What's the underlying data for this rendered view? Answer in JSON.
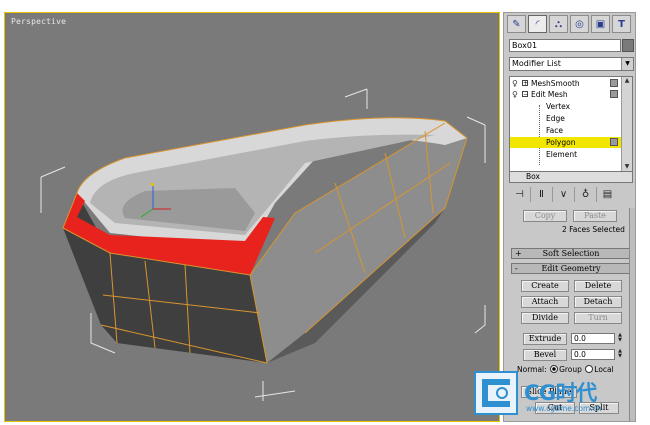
{
  "viewport": {
    "label": "Perspective"
  },
  "command_panel": {
    "tabs": [
      {
        "icon": "create-tab-icon",
        "glyph": "✎"
      },
      {
        "icon": "modify-tab-icon",
        "glyph": "◜"
      },
      {
        "icon": "hierarchy-tab-icon",
        "glyph": "⛬"
      },
      {
        "icon": "motion-tab-icon",
        "glyph": "◎"
      },
      {
        "icon": "display-tab-icon",
        "glyph": "▣"
      },
      {
        "icon": "utilities-tab-icon",
        "glyph": "T"
      }
    ],
    "object_name": "Box01",
    "modifier_list": "Modifier List",
    "stack": {
      "meshsmooth": "MeshSmooth",
      "edit_mesh": "Edit Mesh",
      "vertex": "Vertex",
      "edge": "Edge",
      "face": "Face",
      "polygon": "Polygon",
      "element": "Element",
      "base": "Box"
    },
    "stack_selected": "Polygon",
    "selection": {
      "copy": "Copy",
      "paste": "Paste",
      "status": "2 Faces Selected"
    },
    "soft_selection": {
      "toggle": "+",
      "title": "Soft Selection"
    },
    "edit_geometry": {
      "toggle": "-",
      "title": "Edit Geometry",
      "create": "Create",
      "delete": "Delete",
      "attach": "Attach",
      "detach": "Detach",
      "divide": "Divide",
      "turn": "Turn",
      "extrude": "Extrude",
      "extrude_value": "0.0",
      "bevel": "Bevel",
      "bevel_value": "0.0",
      "normal_label": "Normal:",
      "group": "Group",
      "local": "Local",
      "slice_plane": "Slice Plane",
      "cut": "Cut",
      "split": "Split"
    }
  },
  "watermark": {
    "title": "CG时代",
    "url": "www.cgtime.com.cn"
  },
  "colors": {
    "viewport_bg": "#7a7a7a",
    "active_border": "#e6c200",
    "selected_face": "#e8231d",
    "wire_orange": "#d9952e",
    "stack_highlight": "#f2e600",
    "watermark_blue": "#2e8fd1"
  }
}
